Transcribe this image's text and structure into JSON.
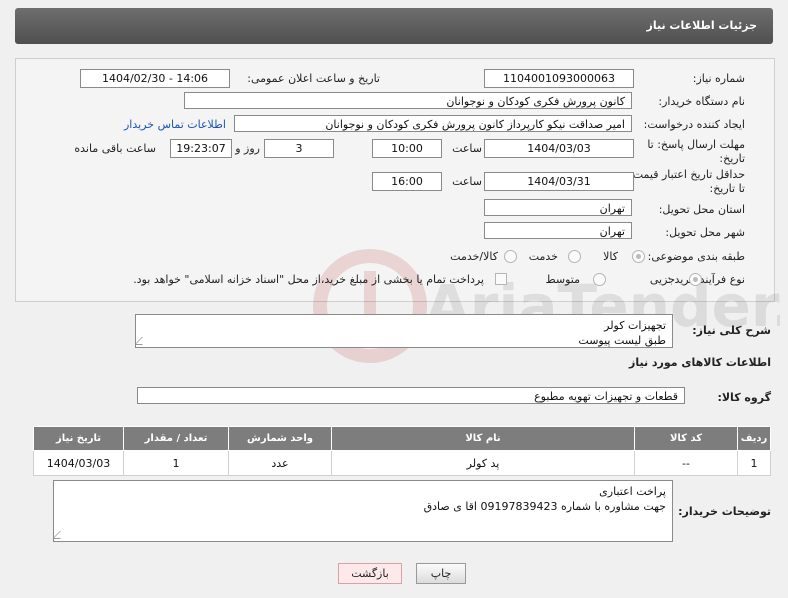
{
  "header": {
    "title": "جزئیات اطلاعات نیاز"
  },
  "form": {
    "need_number_label": "شماره نیاز:",
    "need_number": "1104001093000063",
    "announce_label": "تاریخ و ساعت اعلان عمومی:",
    "announce_value": "1404/02/30 - 14:06",
    "buyer_org_label": "نام دستگاه خریدار:",
    "buyer_org": "کانون پرورش فکری کودکان و نوجوانان",
    "creator_label": "ایجاد کننده درخواست:",
    "creator": "امیر صداقت نیکو کارپرداز کانون پرورش فکری کودکان و نوجوانان",
    "contact_link": "اطلاعات تماس خریدار",
    "deadline_label_1": "مهلت ارسال پاسخ: تا",
    "deadline_label_2": "تاریخ:",
    "deadline_date": "1404/03/03",
    "time_label": "ساعت",
    "deadline_time": "10:00",
    "days_value": "3",
    "days_label": "روز و",
    "remaining_time": "19:23:07",
    "remaining_label": "ساعت باقی مانده",
    "validity_label_1": "حداقل تاریخ اعتبار قیمت:",
    "validity_label_2": "تا تاریخ:",
    "validity_date": "1404/03/31",
    "validity_time": "16:00",
    "province_label": "استان محل تحویل:",
    "province": "تهران",
    "city_label": "شهر محل تحویل:",
    "city": "تهران",
    "category_label": "طبقه بندی موضوعی:",
    "category_options": [
      "کالا",
      "خدمت",
      "کالا/خدمت"
    ],
    "process_label": "نوع فرآیند خرید :",
    "process_options": [
      "جزیی",
      "متوسط"
    ],
    "payment_note": "پرداخت تمام یا بخشی از مبلغ خرید،از محل \"اسناد خزانه اسلامی\" خواهد بود."
  },
  "description": {
    "label": "شرح کلی نیاز:",
    "line1": "تجهیزات کولر",
    "line2": "طبق لیست پیوست"
  },
  "goods": {
    "section_title": "اطلاعات کالاهای مورد نیاز",
    "group_label": "گروه کالا:",
    "group_value": "قطعات و تجهیزات تهویه مطبوع",
    "columns": [
      "ردیف",
      "کد کالا",
      "نام کالا",
      "واحد شمارش",
      "تعداد / مقدار",
      "تاریخ نیاز"
    ],
    "rows": [
      {
        "row": "1",
        "code": "--",
        "name": "پد کولر",
        "unit": "عدد",
        "qty": "1",
        "date": "1404/03/03"
      }
    ]
  },
  "buyer_notes": {
    "label": "توضیحات خریدار:",
    "line1": "پراخت اعتباری",
    "line2": "جهت مشاوره با شماره 09197839423 اقا ی صادق"
  },
  "buttons": {
    "print": "چاپ",
    "back": "بازگشت"
  },
  "watermark": {
    "text": "AriaTender.neT"
  }
}
